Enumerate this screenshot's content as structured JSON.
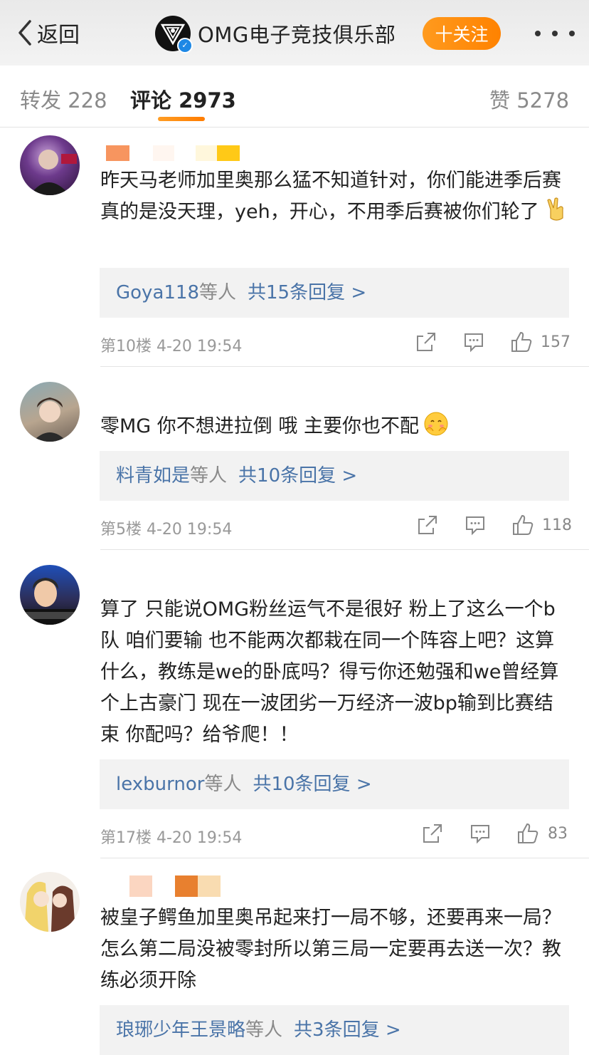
{
  "header": {
    "back_label": "返回",
    "club_name": "OMG电子竞技俱乐部",
    "follow_label": "十关注",
    "more_icon": "more-icon"
  },
  "tabs": {
    "repost_label": "转发 228",
    "comment_label": "评论 2973",
    "like_label": "赞 5278",
    "active_color": "#ff8200"
  },
  "comments": [
    {
      "text": "昨天马老师加里奥那么猛不知道针对，你们能进季后赛真的是没天理，yeh，开心，不用季后赛被你们轮了",
      "emoji": "victory-hand-emoji",
      "reply_names": "Goya118",
      "reply_mid": "等人",
      "reply_count": "共15条回复 >",
      "floor": "第10楼",
      "time": "4-20 19:54",
      "likes": "157"
    },
    {
      "text": "零MG 你不想进拉倒 哦 主要你也不配",
      "emoji": "blushing-hands-emoji",
      "reply_names": "料青如是",
      "reply_mid": "等人",
      "reply_count": "共10条回复 >",
      "floor": "第5楼",
      "time": "4-20 19:54",
      "likes": "118"
    },
    {
      "text": "算了 只能说OMG粉丝运气不是很好 粉上了这么一个b队 咱们要输 也不能两次都栽在同一个阵容上吧？这算什么，教练是we的卧底吗？得亏你还勉强和we曾经算个上古豪门 现在一波团劣一万经济一波bp输到比赛结束 你配吗？给爷爬！！",
      "reply_names": "lexburnor",
      "reply_mid": "等人",
      "reply_count": "共10条回复 >",
      "floor": "第17楼",
      "time": "4-20 19:54",
      "likes": "83"
    },
    {
      "text": "被皇子鳄鱼加里奥吊起来打一局不够，还要再来一局？怎么第二局没被零封所以第三局一定要再去送一次？教练必须开除",
      "reply_names": "琅琊少年王景略",
      "reply_mid": "等人",
      "reply_count": "共3条回复 >"
    }
  ]
}
